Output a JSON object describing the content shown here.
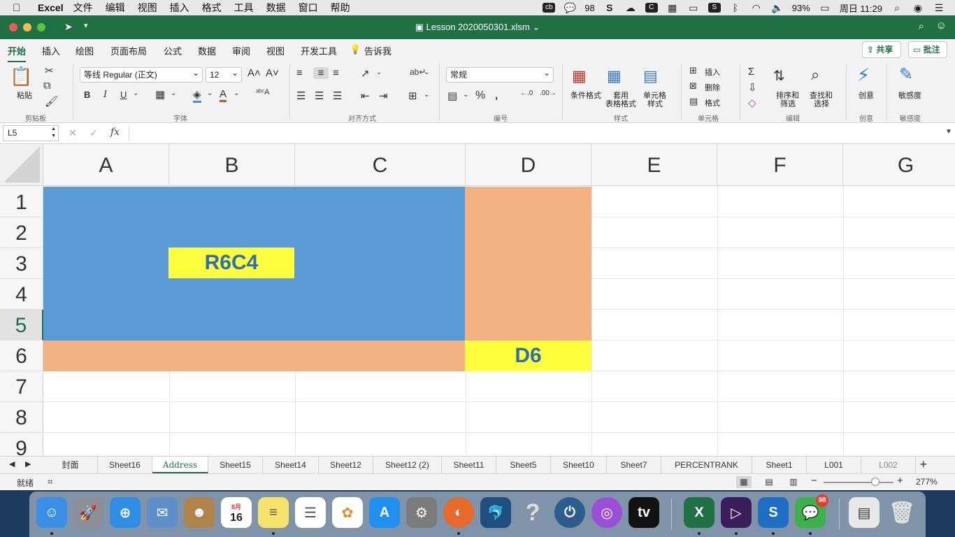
{
  "menubar": {
    "app_name": "Excel",
    "items": [
      "文件",
      "编辑",
      "视图",
      "插入",
      "格式",
      "工具",
      "数据",
      "窗口",
      "帮助"
    ],
    "wechat_count": "98",
    "battery": "93%",
    "clock": "周日 11:29"
  },
  "window": {
    "title": "Lesson 2020050301.xlsm"
  },
  "ribbon": {
    "tabs": [
      "开始",
      "插入",
      "绘图",
      "页面布局",
      "公式",
      "数据",
      "审阅",
      "视图",
      "开发工具",
      "告诉我"
    ],
    "share_label": "共享",
    "comment_label": "批注",
    "paste_label": "粘贴",
    "font_name": "等线 Regular (正文)",
    "font_size": "12",
    "number_format": "常规",
    "bold": "B",
    "italic": "I",
    "underline": "U",
    "conditional_format": "条件格式",
    "table_format_line1": "套用",
    "table_format_line2": "表格格式",
    "cell_style_line1": "单元格",
    "cell_style_line2": "样式",
    "insert_label": "插入",
    "delete_label": "删除",
    "format_label": "格式",
    "sort_filter_line1": "排序和",
    "sort_filter_line2": "筛选",
    "find_select_line1": "查找和",
    "find_select_line2": "选择",
    "ideas_label": "创意",
    "sensitivity_label": "敏感度",
    "groups": {
      "clipboard": "剪贴板",
      "font": "字体",
      "alignment": "对齐方式",
      "number": "编号",
      "styles": "样式",
      "cells": "单元格",
      "editing": "编辑",
      "ideas": "创意",
      "sensitivity": "敏感度"
    }
  },
  "formula_bar": {
    "name_box": "L5",
    "fx": "fx",
    "content": ""
  },
  "grid": {
    "columns": [
      "A",
      "B",
      "C",
      "D",
      "E",
      "F",
      "G"
    ],
    "rows": [
      "1",
      "2",
      "3",
      "4",
      "5",
      "6",
      "7",
      "8",
      "9"
    ],
    "selected_row": "5",
    "cells": {
      "B3": "R6C4",
      "D6": "D6"
    },
    "colors": {
      "blue_fill": "#5b9bd5",
      "orange_fill": "#f4b183",
      "yellow_fill": "#ffff3f",
      "label_text": "#2e6fb0"
    }
  },
  "sheets": {
    "tabs": [
      "封面",
      "Sheet16",
      "Address",
      "Sheet15",
      "Sheet14",
      "Sheet12",
      "Sheet12 (2)",
      "Sheet11",
      "Sheet5",
      "Sheet10",
      "Sheet7",
      "PERCENTRANK",
      "Sheet1",
      "L001",
      "L002"
    ],
    "active": "Address"
  },
  "status": {
    "text": "就绪",
    "zoom": "277%"
  },
  "dock": {
    "calendar_month": "8月",
    "calendar_day": "16",
    "wechat_badge": "98"
  }
}
